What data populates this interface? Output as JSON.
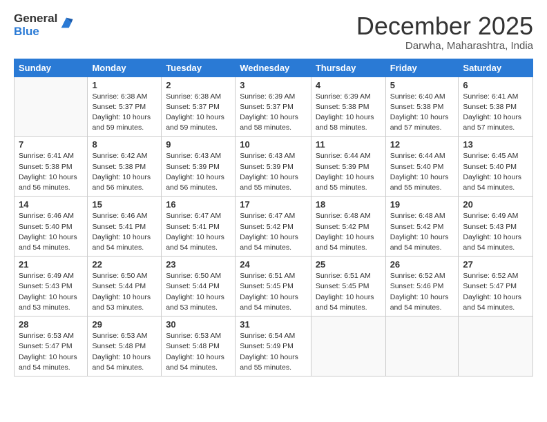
{
  "logo": {
    "general": "General",
    "blue": "Blue"
  },
  "title": "December 2025",
  "location": "Darwha, Maharashtra, India",
  "days_of_week": [
    "Sunday",
    "Monday",
    "Tuesday",
    "Wednesday",
    "Thursday",
    "Friday",
    "Saturday"
  ],
  "weeks": [
    [
      {
        "day": "",
        "info": ""
      },
      {
        "day": "1",
        "info": "Sunrise: 6:38 AM\nSunset: 5:37 PM\nDaylight: 10 hours\nand 59 minutes."
      },
      {
        "day": "2",
        "info": "Sunrise: 6:38 AM\nSunset: 5:37 PM\nDaylight: 10 hours\nand 59 minutes."
      },
      {
        "day": "3",
        "info": "Sunrise: 6:39 AM\nSunset: 5:37 PM\nDaylight: 10 hours\nand 58 minutes."
      },
      {
        "day": "4",
        "info": "Sunrise: 6:39 AM\nSunset: 5:38 PM\nDaylight: 10 hours\nand 58 minutes."
      },
      {
        "day": "5",
        "info": "Sunrise: 6:40 AM\nSunset: 5:38 PM\nDaylight: 10 hours\nand 57 minutes."
      },
      {
        "day": "6",
        "info": "Sunrise: 6:41 AM\nSunset: 5:38 PM\nDaylight: 10 hours\nand 57 minutes."
      }
    ],
    [
      {
        "day": "7",
        "info": "Sunrise: 6:41 AM\nSunset: 5:38 PM\nDaylight: 10 hours\nand 56 minutes."
      },
      {
        "day": "8",
        "info": "Sunrise: 6:42 AM\nSunset: 5:38 PM\nDaylight: 10 hours\nand 56 minutes."
      },
      {
        "day": "9",
        "info": "Sunrise: 6:43 AM\nSunset: 5:39 PM\nDaylight: 10 hours\nand 56 minutes."
      },
      {
        "day": "10",
        "info": "Sunrise: 6:43 AM\nSunset: 5:39 PM\nDaylight: 10 hours\nand 55 minutes."
      },
      {
        "day": "11",
        "info": "Sunrise: 6:44 AM\nSunset: 5:39 PM\nDaylight: 10 hours\nand 55 minutes."
      },
      {
        "day": "12",
        "info": "Sunrise: 6:44 AM\nSunset: 5:40 PM\nDaylight: 10 hours\nand 55 minutes."
      },
      {
        "day": "13",
        "info": "Sunrise: 6:45 AM\nSunset: 5:40 PM\nDaylight: 10 hours\nand 54 minutes."
      }
    ],
    [
      {
        "day": "14",
        "info": "Sunrise: 6:46 AM\nSunset: 5:40 PM\nDaylight: 10 hours\nand 54 minutes."
      },
      {
        "day": "15",
        "info": "Sunrise: 6:46 AM\nSunset: 5:41 PM\nDaylight: 10 hours\nand 54 minutes."
      },
      {
        "day": "16",
        "info": "Sunrise: 6:47 AM\nSunset: 5:41 PM\nDaylight: 10 hours\nand 54 minutes."
      },
      {
        "day": "17",
        "info": "Sunrise: 6:47 AM\nSunset: 5:42 PM\nDaylight: 10 hours\nand 54 minutes."
      },
      {
        "day": "18",
        "info": "Sunrise: 6:48 AM\nSunset: 5:42 PM\nDaylight: 10 hours\nand 54 minutes."
      },
      {
        "day": "19",
        "info": "Sunrise: 6:48 AM\nSunset: 5:42 PM\nDaylight: 10 hours\nand 54 minutes."
      },
      {
        "day": "20",
        "info": "Sunrise: 6:49 AM\nSunset: 5:43 PM\nDaylight: 10 hours\nand 54 minutes."
      }
    ],
    [
      {
        "day": "21",
        "info": "Sunrise: 6:49 AM\nSunset: 5:43 PM\nDaylight: 10 hours\nand 53 minutes."
      },
      {
        "day": "22",
        "info": "Sunrise: 6:50 AM\nSunset: 5:44 PM\nDaylight: 10 hours\nand 53 minutes."
      },
      {
        "day": "23",
        "info": "Sunrise: 6:50 AM\nSunset: 5:44 PM\nDaylight: 10 hours\nand 53 minutes."
      },
      {
        "day": "24",
        "info": "Sunrise: 6:51 AM\nSunset: 5:45 PM\nDaylight: 10 hours\nand 54 minutes."
      },
      {
        "day": "25",
        "info": "Sunrise: 6:51 AM\nSunset: 5:45 PM\nDaylight: 10 hours\nand 54 minutes."
      },
      {
        "day": "26",
        "info": "Sunrise: 6:52 AM\nSunset: 5:46 PM\nDaylight: 10 hours\nand 54 minutes."
      },
      {
        "day": "27",
        "info": "Sunrise: 6:52 AM\nSunset: 5:47 PM\nDaylight: 10 hours\nand 54 minutes."
      }
    ],
    [
      {
        "day": "28",
        "info": "Sunrise: 6:53 AM\nSunset: 5:47 PM\nDaylight: 10 hours\nand 54 minutes."
      },
      {
        "day": "29",
        "info": "Sunrise: 6:53 AM\nSunset: 5:48 PM\nDaylight: 10 hours\nand 54 minutes."
      },
      {
        "day": "30",
        "info": "Sunrise: 6:53 AM\nSunset: 5:48 PM\nDaylight: 10 hours\nand 54 minutes."
      },
      {
        "day": "31",
        "info": "Sunrise: 6:54 AM\nSunset: 5:49 PM\nDaylight: 10 hours\nand 55 minutes."
      },
      {
        "day": "",
        "info": ""
      },
      {
        "day": "",
        "info": ""
      },
      {
        "day": "",
        "info": ""
      }
    ]
  ]
}
